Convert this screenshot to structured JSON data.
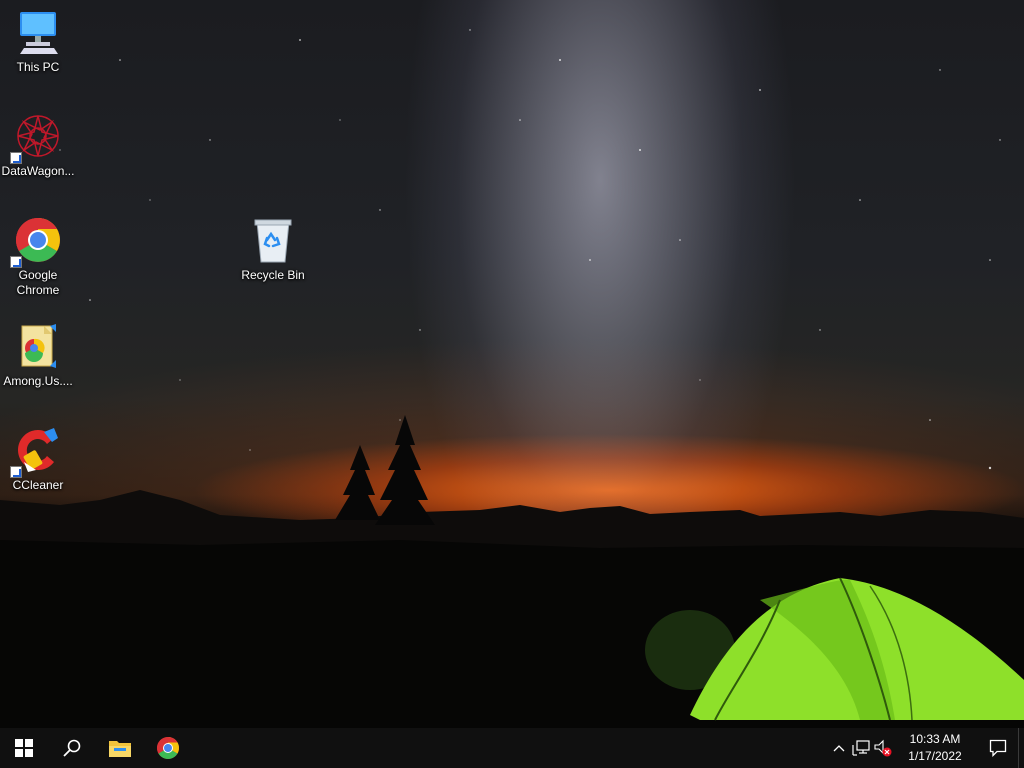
{
  "desktop": {
    "icons": [
      {
        "label": "This PC",
        "icon": "computer-icon"
      },
      {
        "label": "DataWagon...",
        "icon": "datawagon-icon"
      },
      {
        "label": "Google Chrome",
        "icon": "chrome-icon"
      },
      {
        "label": "Among.Us....",
        "icon": "among-us-file-icon"
      },
      {
        "label": "CCleaner",
        "icon": "ccleaner-icon"
      },
      {
        "label": "Recycle Bin",
        "icon": "recycle-bin-icon"
      }
    ]
  },
  "taskbar": {
    "start": "windows-start-icon",
    "search": "search-icon",
    "pinned": [
      "file-explorer-icon",
      "chrome-icon"
    ],
    "tray": {
      "icons": [
        "chevron-up-icon",
        "network-icon",
        "volume-muted-icon"
      ],
      "time": "10:33 AM",
      "date": "1/17/2022",
      "notifications": "action-center-icon"
    }
  },
  "colors": {
    "taskbar_bg": "#101010",
    "tent_green": "#8ee02a",
    "horizon_orange": "#ff6e14"
  }
}
